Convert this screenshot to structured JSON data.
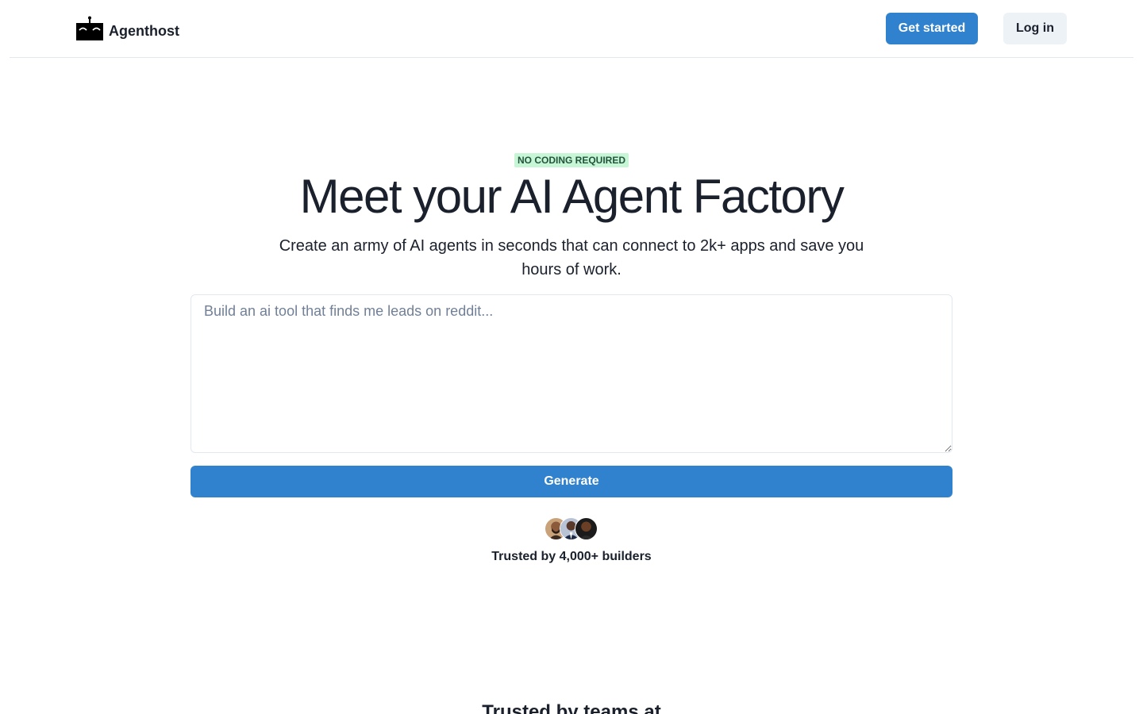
{
  "header": {
    "brand_name": "Agenthost",
    "logo_icon": "robot-face-icon",
    "get_started_label": "Get started",
    "login_label": "Log in"
  },
  "hero": {
    "badge": "NO CODING REQUIRED",
    "title": "Meet your AI Agent Factory",
    "subtitle": "Create an army of AI agents in seconds that can connect to 2k+ apps and save you hours of work.",
    "prompt_value": "",
    "prompt_placeholder": "Build an ai tool that finds me leads on reddit...",
    "generate_label": "Generate",
    "trusted_text": "Trusted by 4,000+ builders"
  },
  "social_proof": {
    "heading": "Trusted by teams at"
  },
  "colors": {
    "accent": "#3182ce",
    "badge_bg": "#c6f6d5",
    "badge_text": "#22543d",
    "text": "#1a202c",
    "placeholder": "#718096",
    "border": "#e2e8f0"
  }
}
